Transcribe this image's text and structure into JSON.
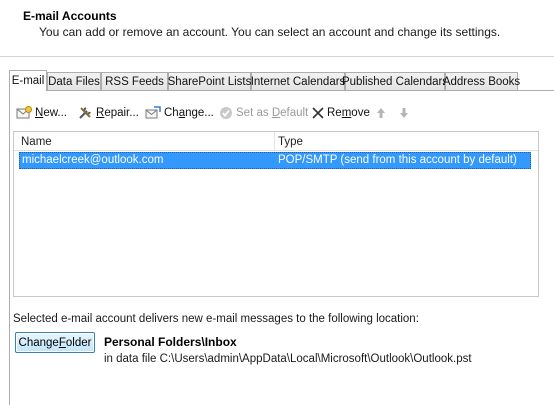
{
  "header": {
    "title": "E-mail Accounts",
    "subtitle": "You can add or remove an account. You can select an account and change its settings."
  },
  "tabs": [
    {
      "label": "E-mail",
      "active": true
    },
    {
      "label": "Data Files",
      "active": false
    },
    {
      "label": "RSS Feeds",
      "active": false
    },
    {
      "label": "SharePoint Lists",
      "active": false
    },
    {
      "label": "Internet Calendars",
      "active": false
    },
    {
      "label": "Published Calendars",
      "active": false
    },
    {
      "label": "Address Books",
      "active": false
    }
  ],
  "toolbar": {
    "new": {
      "label_pre": "",
      "label_ul": "N",
      "label_post": "ew...",
      "icon": "new-account-icon"
    },
    "repair": {
      "label_pre": "",
      "label_ul": "R",
      "label_post": "epair...",
      "icon": "repair-tools-icon"
    },
    "change": {
      "label_pre": "Ch",
      "label_ul": "a",
      "label_post": "nge...",
      "icon": "change-account-icon"
    },
    "set_default": {
      "label_pre": "Set as ",
      "label_ul": "D",
      "label_post": "efault",
      "icon": "checkmark-circle-icon",
      "disabled": true
    },
    "remove": {
      "label_pre": "Re",
      "label_ul": "m",
      "label_post": "ove",
      "icon": "x-icon"
    },
    "move_up": {
      "icon": "arrow-up-icon",
      "disabled": true
    },
    "move_down": {
      "icon": "arrow-down-icon",
      "disabled": true
    }
  },
  "list": {
    "columns": [
      "Name",
      "Type"
    ],
    "rows": [
      {
        "name": "michaelcreek@outlook.com",
        "type": "POP/SMTP (send from this account by default)",
        "selected": true
      }
    ]
  },
  "delivery": {
    "label": "Selected e-mail account delivers new e-mail messages to the following location:",
    "button_pre": "Change ",
    "button_ul": "F",
    "button_post": "older",
    "folder_name": "Personal Folders\\Inbox",
    "folder_path": "in data file C:\\Users\\admin\\AppData\\Local\\Microsoft\\Outlook\\Outlook.pst"
  },
  "colors": {
    "selection": "#3399ff",
    "tab_border": "#adadad",
    "disabled_text": "#9a9a9a"
  }
}
